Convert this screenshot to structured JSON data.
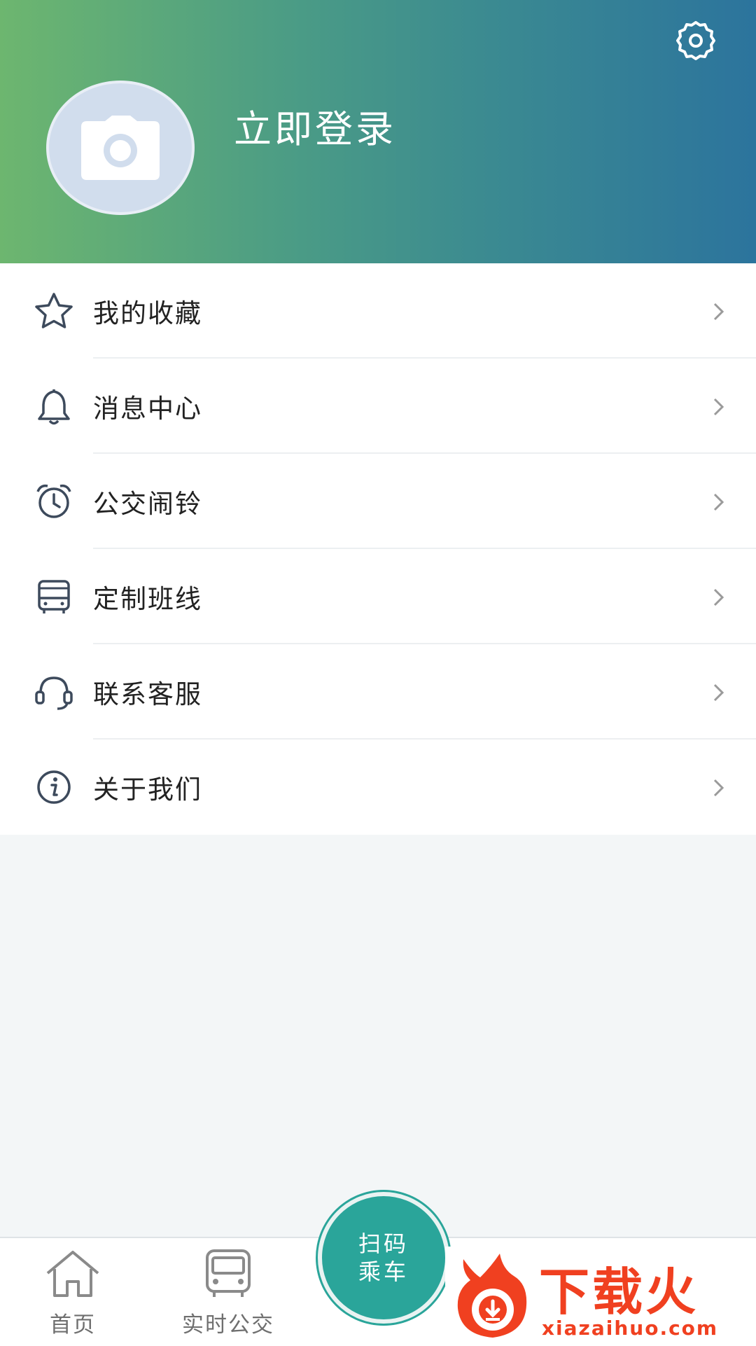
{
  "header": {
    "login_label": "立即登录"
  },
  "menu": {
    "items": [
      {
        "label": "我的收藏",
        "icon": "star-icon"
      },
      {
        "label": "消息中心",
        "icon": "bell-icon"
      },
      {
        "label": "公交闹铃",
        "icon": "alarm-clock-icon"
      },
      {
        "label": "定制班线",
        "icon": "bus-icon"
      },
      {
        "label": "联系客服",
        "icon": "headset-icon"
      },
      {
        "label": "关于我们",
        "icon": "info-icon"
      }
    ]
  },
  "tabbar": {
    "home_label": "首页",
    "realtime_label": "实时公交",
    "scan_line1": "扫码",
    "scan_line2": "乘车"
  },
  "watermark": {
    "brand": "下载火",
    "url": "xiazaihuo.com"
  },
  "colors": {
    "header_gradient_start": "#6db66f",
    "header_gradient_end": "#2c749d",
    "scan_button": "#2aa59a",
    "icon_stroke": "#3d4a5c",
    "watermark": "#f04020"
  }
}
